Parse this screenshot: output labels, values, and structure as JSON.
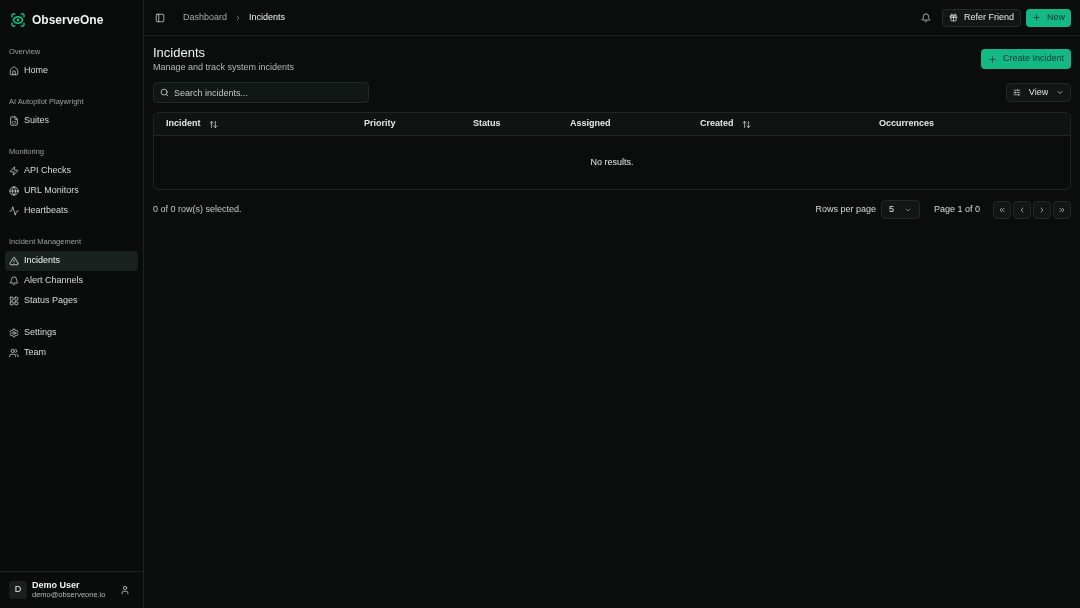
{
  "sidebar": {
    "brand": "ObserveOne",
    "groups": [
      {
        "label": "Overview",
        "items": [
          {
            "label": "Home",
            "selected": false
          }
        ]
      },
      {
        "label": "AI Autopilot Playwright",
        "items": [
          {
            "label": "Suites",
            "selected": false
          }
        ]
      },
      {
        "label": "Monitoring",
        "items": [
          {
            "label": "API Checks",
            "selected": false
          },
          {
            "label": "URL Monitors",
            "selected": false
          },
          {
            "label": "Heartbeats",
            "selected": false
          }
        ]
      },
      {
        "label": "Incident Management",
        "items": [
          {
            "label": "Incidents",
            "selected": true
          },
          {
            "label": "Alert Channels",
            "selected": false
          },
          {
            "label": "Status Pages",
            "selected": false
          }
        ]
      },
      {
        "items": [
          {
            "label": "Settings",
            "selected": false
          },
          {
            "label": "Team",
            "selected": false
          }
        ]
      }
    ],
    "user": {
      "initial": "D",
      "name": "Demo User",
      "email": "demo@observeone.io"
    }
  },
  "header": {
    "breadcrumbs": [
      {
        "label": "Dashboard",
        "current": false
      },
      {
        "label": "Incidents",
        "current": true
      }
    ],
    "buttons": [
      {
        "label": "Refer Friend",
        "kind": "outline"
      },
      {
        "label": "New",
        "kind": "primary"
      }
    ]
  },
  "page": {
    "title": "Incidents",
    "subtitle": "Manage and track system incidents",
    "create_button": "Create Incident",
    "search": {
      "placeholder": "Search incidents..."
    },
    "view_button": "View"
  },
  "table": {
    "columns": [
      {
        "label": "Incident",
        "sortable": true
      },
      {
        "label": "Priority",
        "sortable": false
      },
      {
        "label": "Status",
        "sortable": false
      },
      {
        "label": "Assigned",
        "sortable": false
      },
      {
        "label": "Created",
        "sortable": true
      },
      {
        "label": "Occurrences",
        "sortable": false
      }
    ],
    "empty_text": "No results."
  },
  "footer": {
    "selection": "0 of 0 row(s) selected.",
    "rows_per_page_label": "Rows per page",
    "rows_per_page": "5",
    "page_info": "Page 1 of 0"
  }
}
